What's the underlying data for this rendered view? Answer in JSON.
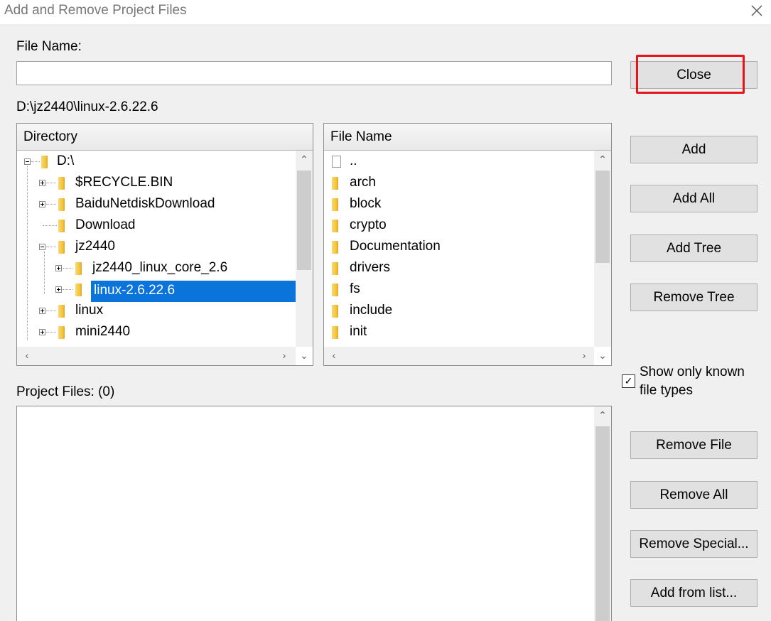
{
  "window": {
    "title": "Add and Remove Project Files"
  },
  "file_name": {
    "label": "File Name:",
    "value": "",
    "placeholder": ""
  },
  "current_path": "D:\\jz2440\\linux-2.6.22.6",
  "directory": {
    "header": "Directory",
    "items": [
      {
        "label": "D:\\",
        "expander": "minus"
      },
      {
        "label": "$RECYCLE.BIN",
        "expander": "plus"
      },
      {
        "label": "BaiduNetdiskDownload",
        "expander": "plus"
      },
      {
        "label": "Download",
        "expander": "none"
      },
      {
        "label": "jz2440",
        "expander": "minus"
      },
      {
        "label": "jz2440_linux_core_2.6",
        "expander": "plus"
      },
      {
        "label": "linux-2.6.22.6",
        "expander": "plus",
        "selected": true
      },
      {
        "label": "linux",
        "expander": "plus"
      },
      {
        "label": "mini2440",
        "expander": "plus"
      }
    ]
  },
  "files": {
    "header": "File Name",
    "items": [
      {
        "label": "..",
        "icon": "file"
      },
      {
        "label": "arch",
        "icon": "folder"
      },
      {
        "label": "block",
        "icon": "folder"
      },
      {
        "label": "crypto",
        "icon": "folder"
      },
      {
        "label": "Documentation",
        "icon": "folder"
      },
      {
        "label": "drivers",
        "icon": "folder"
      },
      {
        "label": "fs",
        "icon": "folder"
      },
      {
        "label": "include",
        "icon": "folder"
      },
      {
        "label": "init",
        "icon": "folder"
      }
    ]
  },
  "buttons": {
    "close": "Close",
    "add": "Add",
    "add_all": "Add All",
    "add_tree": "Add Tree",
    "remove_tree": "Remove Tree",
    "remove_file": "Remove File",
    "remove_all": "Remove All",
    "remove_special": "Remove Special...",
    "add_from_list": "Add from list..."
  },
  "show_known": {
    "line1": "Show only known",
    "line2": "file types",
    "checked": true
  },
  "project_files": {
    "label": "Project Files: (0)"
  },
  "colors": {
    "highlight": "#e8141b",
    "selection": "#0a74da",
    "folder": "#f5c842"
  }
}
